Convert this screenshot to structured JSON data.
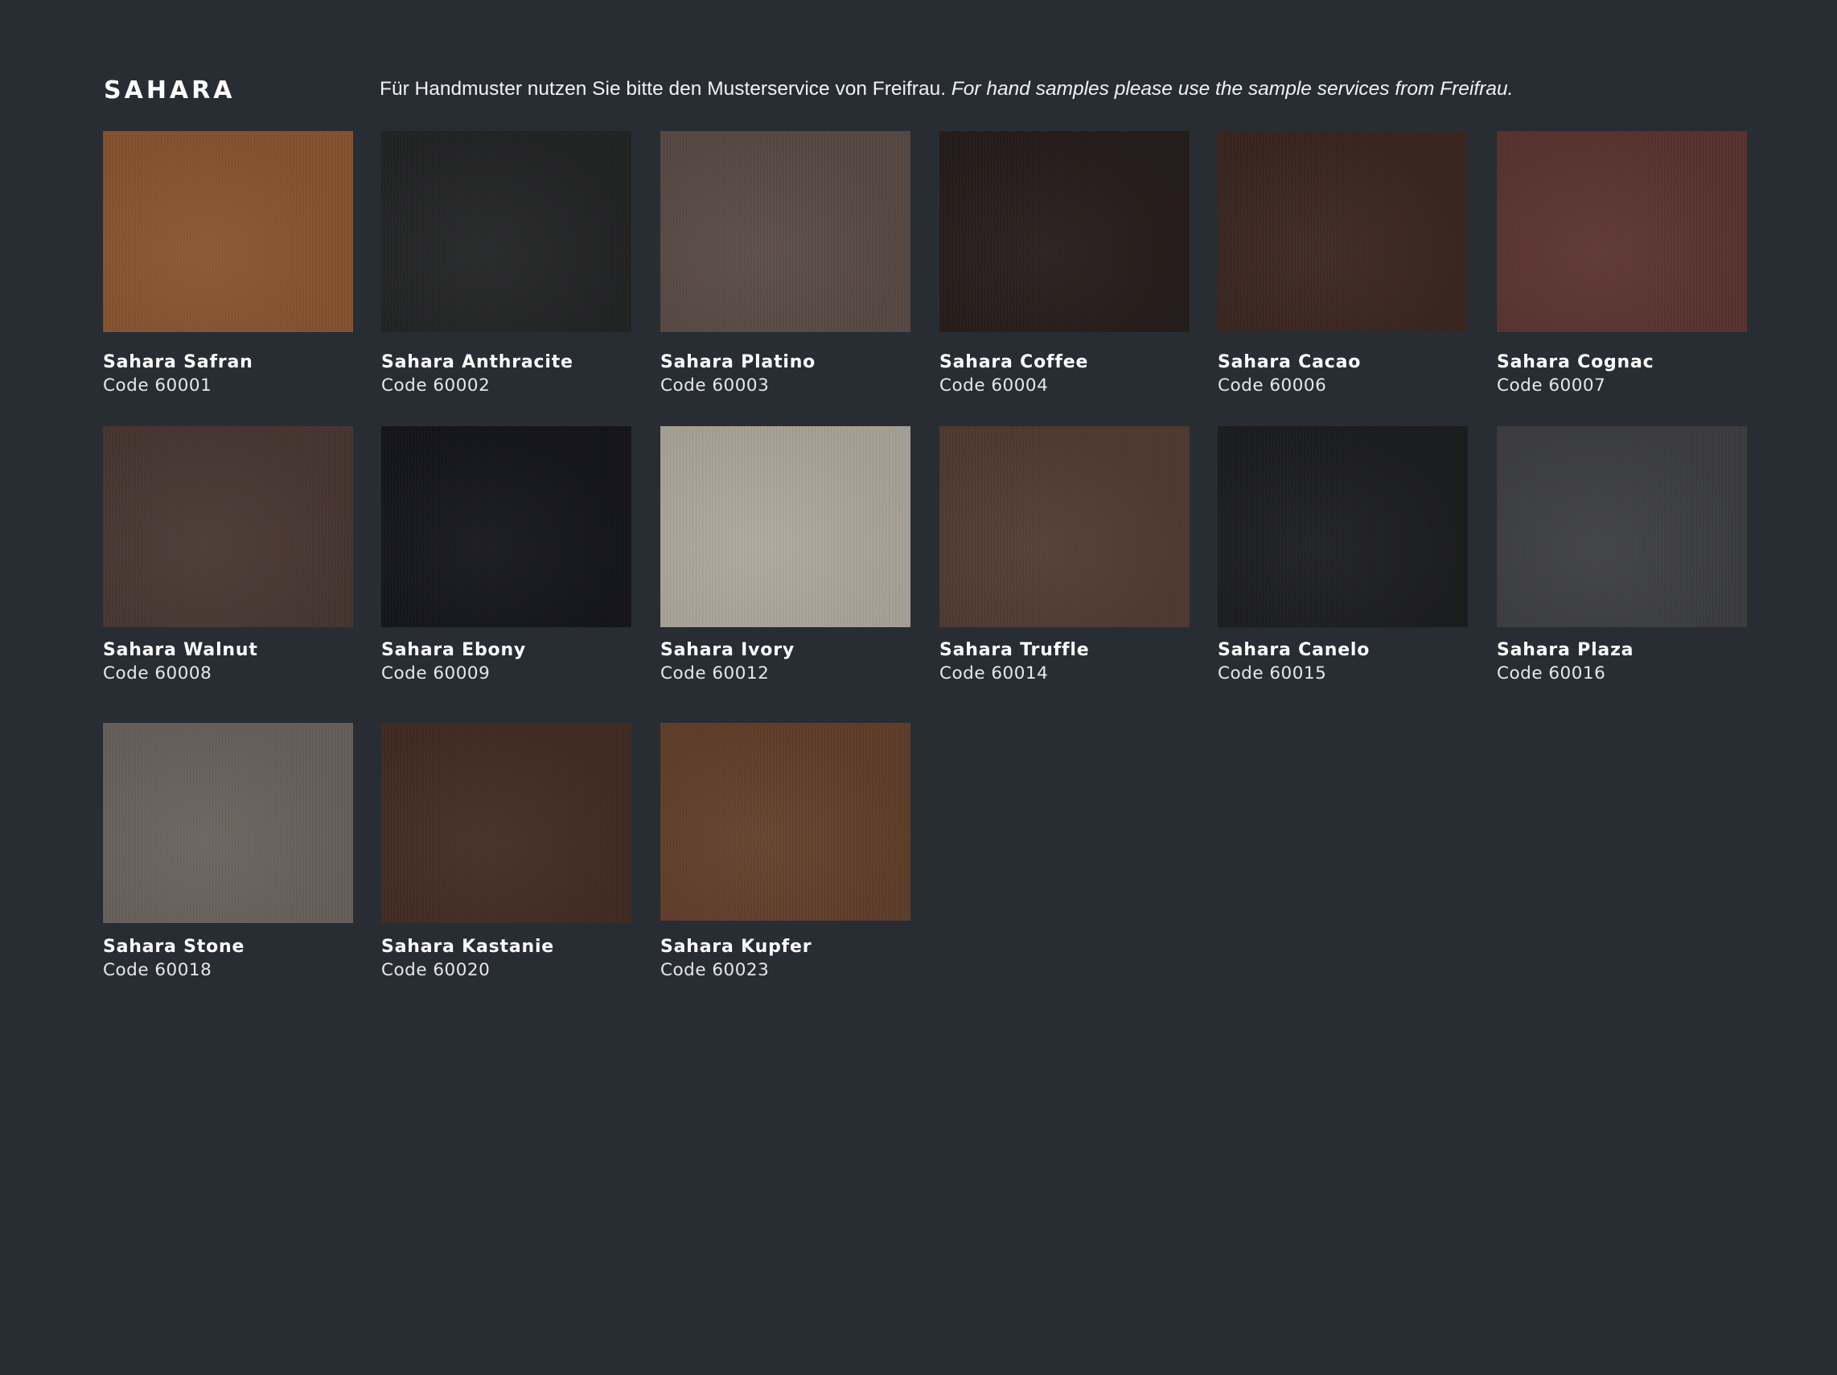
{
  "header": {
    "title": "SAHARA",
    "notice_de": "Für Handmuster nutzen Sie bitte den Musterservice von Freifrau.",
    "notice_en": "For hand samples please use the sample services from Freifrau."
  },
  "swatches": [
    {
      "name": "Sahara Safran",
      "code": "Code 60001",
      "color": "#8a5530"
    },
    {
      "name": "Sahara Anthracite",
      "code": "Code 60002",
      "color": "#232425"
    },
    {
      "name": "Sahara Platino",
      "code": "Code 60003",
      "color": "#5a4b45"
    },
    {
      "name": "Sahara Coffee",
      "code": "Code 60004",
      "color": "#261d1b"
    },
    {
      "name": "Sahara Cacao",
      "code": "Code 60006",
      "color": "#3c2620"
    },
    {
      "name": "Sahara Cognac",
      "code": "Code 60007",
      "color": "#5c3530"
    },
    {
      "name": "Sahara Walnut",
      "code": "Code 60008",
      "color": "#4a3832"
    },
    {
      "name": "Sahara Ebony",
      "code": "Code 60009",
      "color": "#15161c"
    },
    {
      "name": "Sahara Ivory",
      "code": "Code 60012",
      "color": "#aea89d"
    },
    {
      "name": "Sahara Truffle",
      "code": "Code 60014",
      "color": "#523c32"
    },
    {
      "name": "Sahara Canelo",
      "code": "Code 60015",
      "color": "#1c1d1f"
    },
    {
      "name": "Sahara Plaza",
      "code": "Code 60016",
      "color": "#3e3f41"
    },
    {
      "name": "Sahara Stone",
      "code": "Code 60018",
      "color": "#6a635d"
    },
    {
      "name": "Sahara Kastanie",
      "code": "Code 60020",
      "color": "#432d23"
    },
    {
      "name": "Sahara Kupfer",
      "code": "Code 60023",
      "color": "#63402b"
    }
  ]
}
